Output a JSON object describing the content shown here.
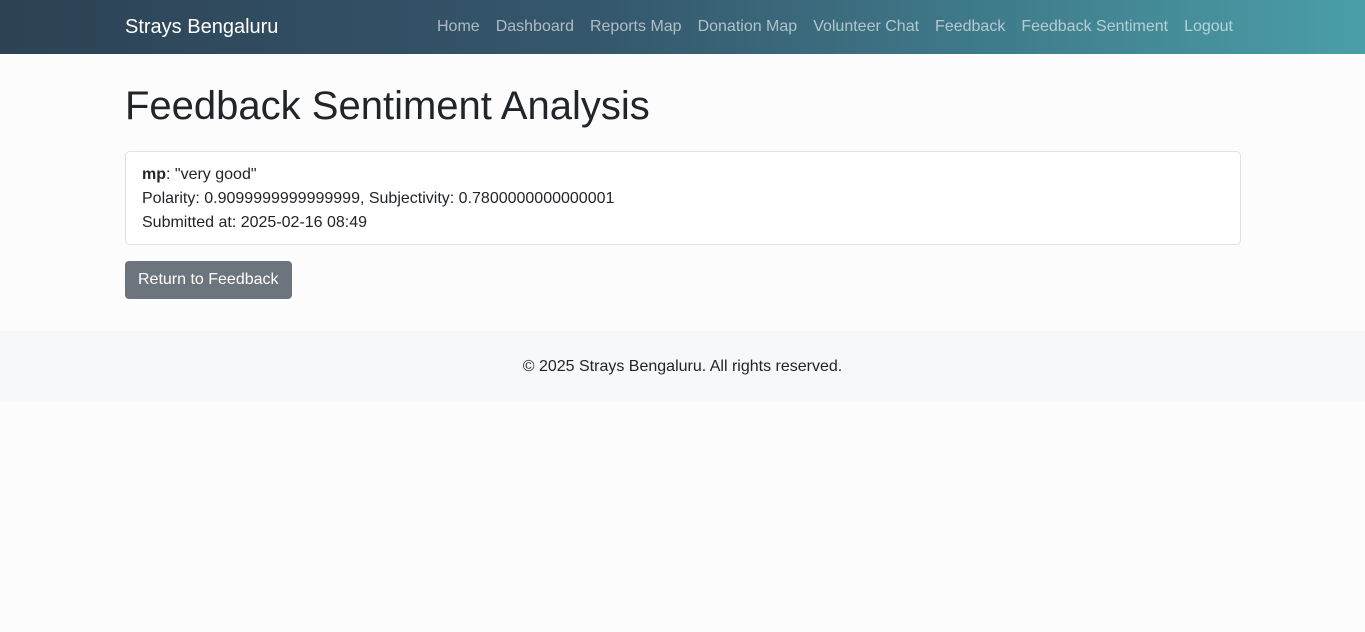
{
  "navbar": {
    "brand": "Strays Bengaluru",
    "links": [
      "Home",
      "Dashboard",
      "Reports Map",
      "Donation Map",
      "Volunteer Chat",
      "Feedback",
      "Feedback Sentiment",
      "Logout"
    ]
  },
  "page": {
    "title": "Feedback Sentiment Analysis"
  },
  "feedback": {
    "author": "mp",
    "separator": ": ",
    "text": "\"very good\"",
    "polarity_label": "Polarity: ",
    "polarity": "0.9099999999999999",
    "subjectivity_label": ", Subjectivity: ",
    "subjectivity": "0.7800000000000001",
    "submitted_label": "Submitted at: ",
    "submitted_at": "2025-02-16 08:49"
  },
  "actions": {
    "return_label": "Return to Feedback"
  },
  "footer": {
    "text": "© 2025 Strays Bengaluru. All rights reserved."
  },
  "colors": {
    "navbar_start": "#2d4255",
    "navbar_end": "#4a9ea8",
    "button": "#6c757d",
    "footer_bg": "#f7f8fa"
  }
}
